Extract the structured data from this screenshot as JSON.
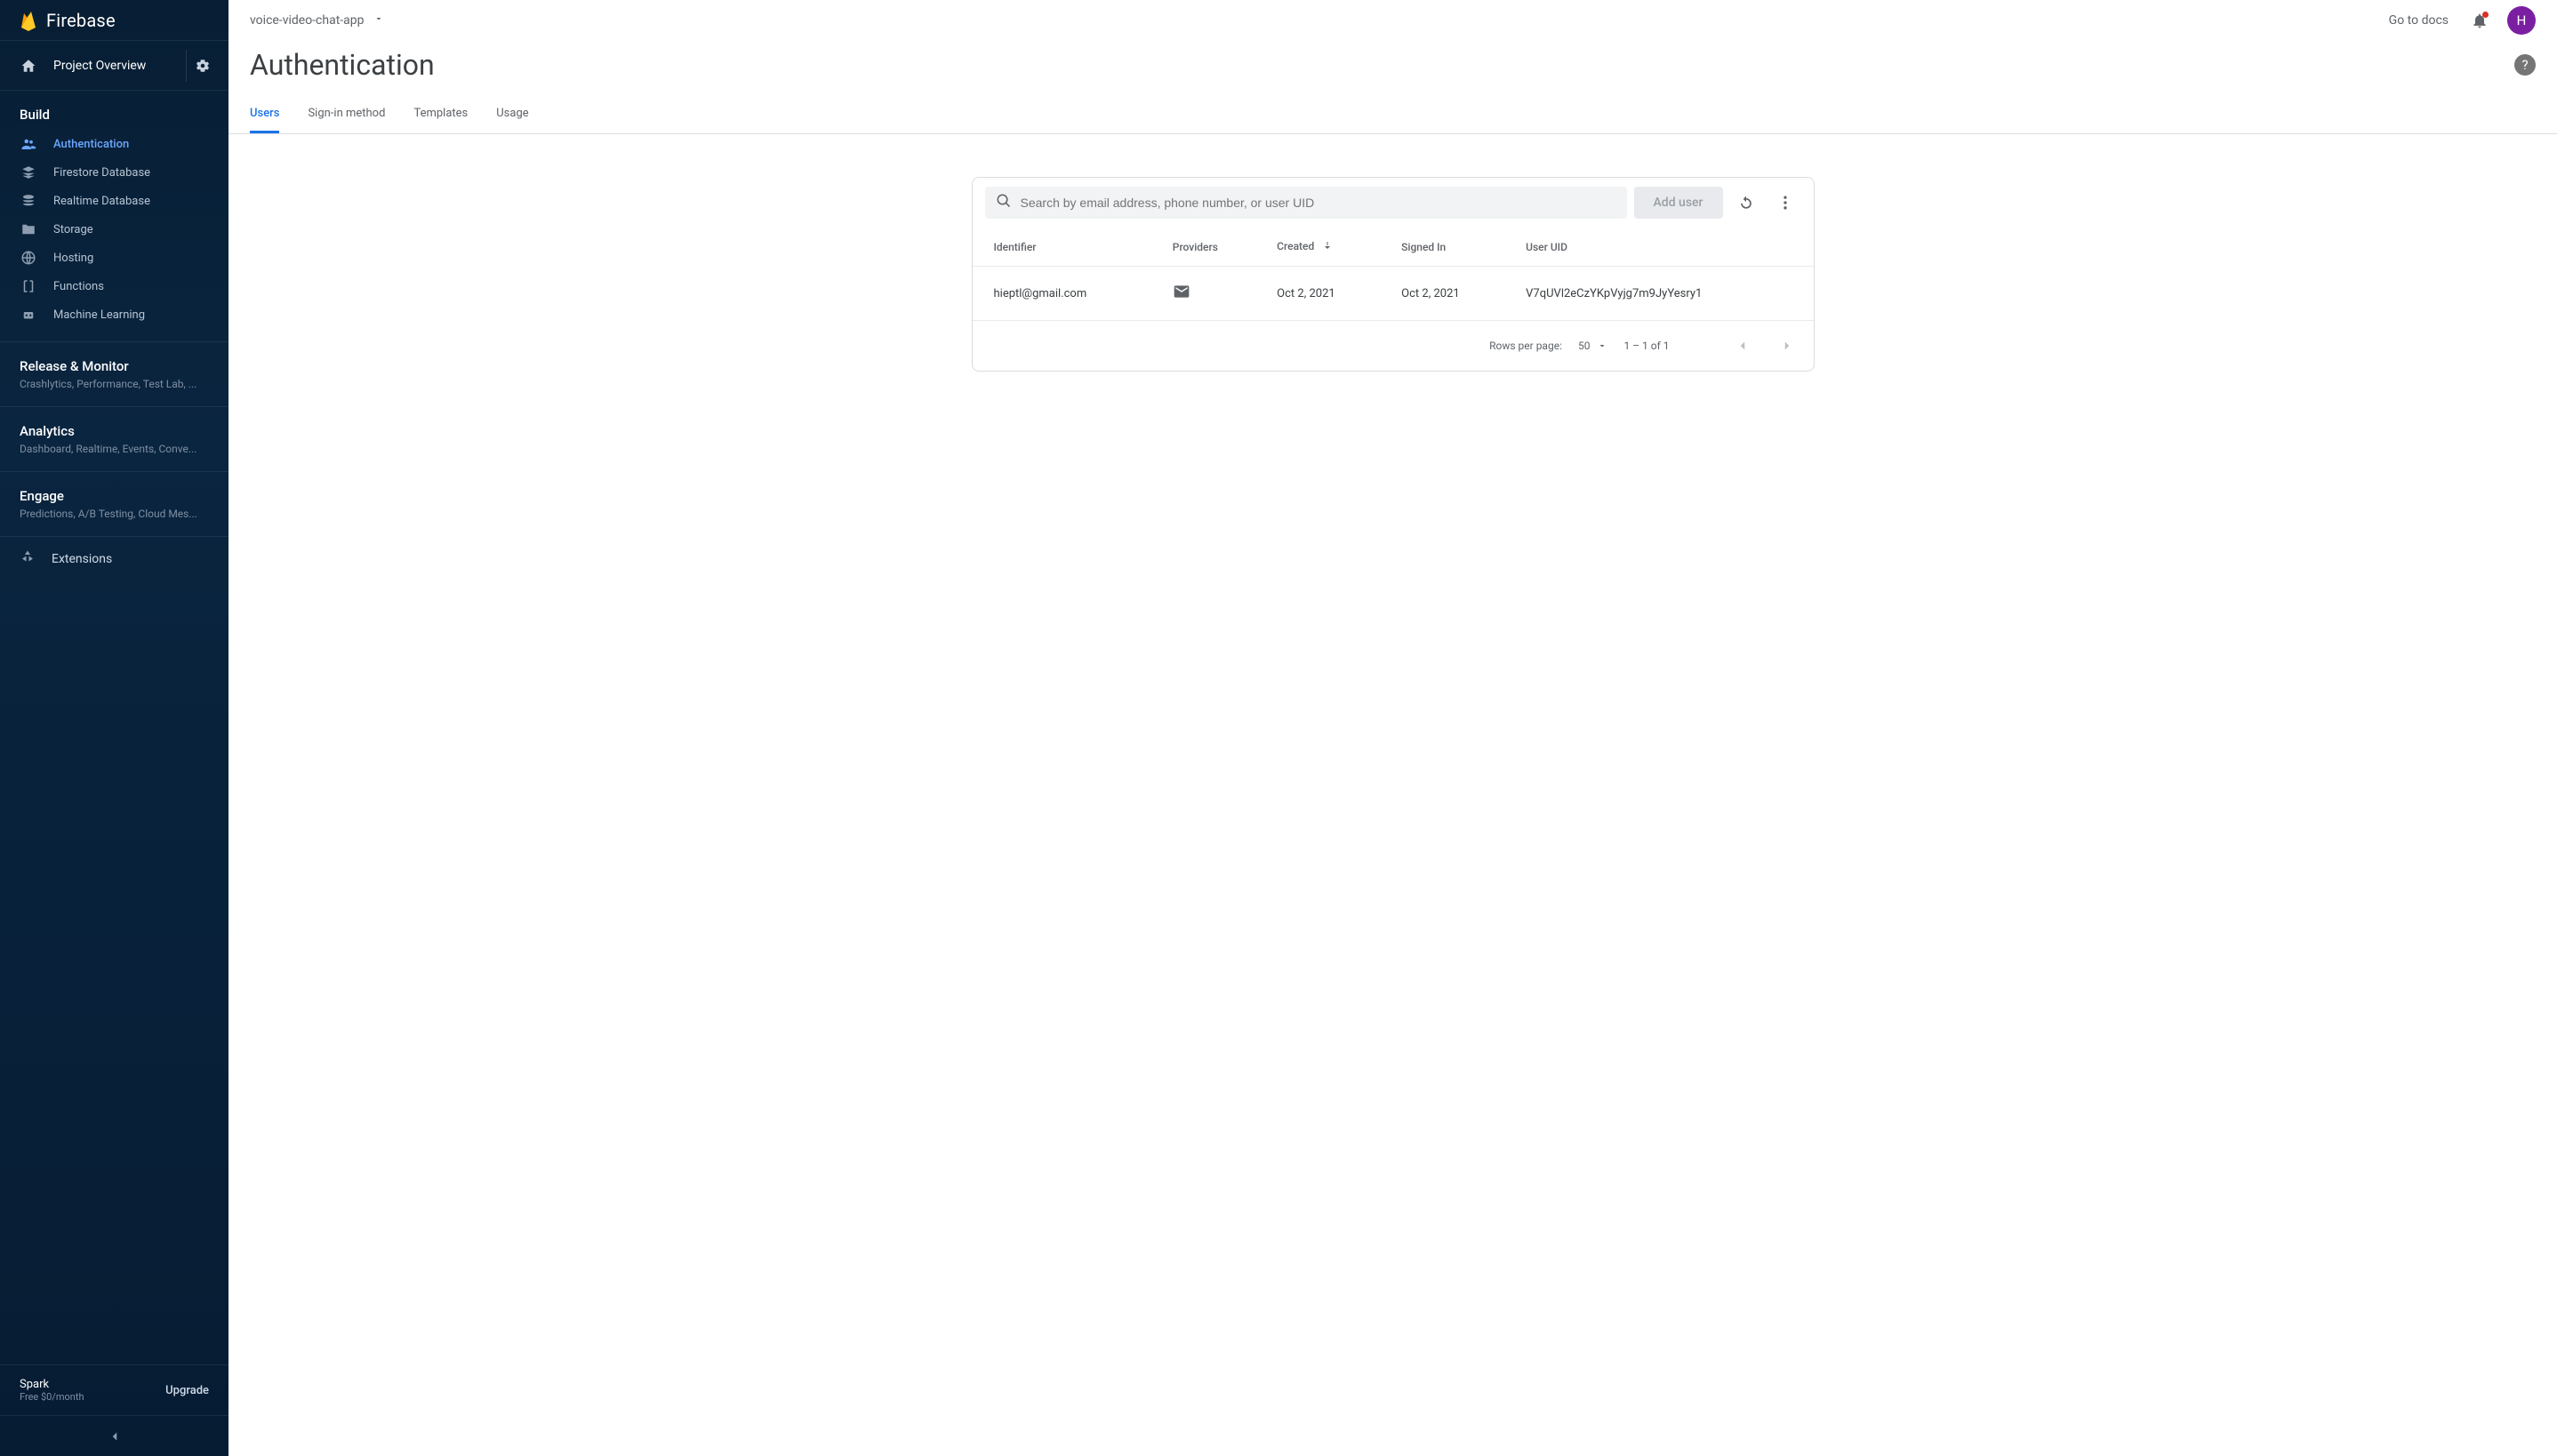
{
  "brand": "Firebase",
  "sidebar": {
    "overview": "Project Overview",
    "build_label": "Build",
    "nav": [
      {
        "label": "Authentication",
        "icon": "people",
        "active": true
      },
      {
        "label": "Firestore Database",
        "icon": "layers"
      },
      {
        "label": "Realtime Database",
        "icon": "dblayers"
      },
      {
        "label": "Storage",
        "icon": "folder"
      },
      {
        "label": "Hosting",
        "icon": "globe"
      },
      {
        "label": "Functions",
        "icon": "functions"
      },
      {
        "label": "Machine Learning",
        "icon": "robot"
      }
    ],
    "groups": [
      {
        "title": "Release & Monitor",
        "sub": "Crashlytics, Performance, Test Lab, ..."
      },
      {
        "title": "Analytics",
        "sub": "Dashboard, Realtime, Events, Conve..."
      },
      {
        "title": "Engage",
        "sub": "Predictions, A/B Testing, Cloud Mes..."
      }
    ],
    "extensions": "Extensions",
    "plan": {
      "name": "Spark",
      "sub": "Free $0/month",
      "upgrade": "Upgrade"
    }
  },
  "topbar": {
    "project": "voice-video-chat-app",
    "docs": "Go to docs",
    "avatar_letter": "H"
  },
  "page": {
    "title": "Authentication",
    "tabs": [
      "Users",
      "Sign-in method",
      "Templates",
      "Usage"
    ],
    "active_tab": 0
  },
  "toolbar": {
    "search_placeholder": "Search by email address, phone number, or user UID",
    "add_user": "Add user"
  },
  "table": {
    "headers": [
      "Identifier",
      "Providers",
      "Created",
      "Signed In",
      "User UID"
    ],
    "sort_col": 2,
    "rows": [
      {
        "identifier": "hieptl@gmail.com",
        "provider": "email",
        "created": "Oct 2, 2021",
        "signed_in": "Oct 2, 2021",
        "uid": "V7qUVl2eCzYKpVyjg7m9JyYesry1"
      }
    ]
  },
  "pager": {
    "rows_label": "Rows per page:",
    "rows_value": "50",
    "range": "1 – 1 of 1"
  }
}
